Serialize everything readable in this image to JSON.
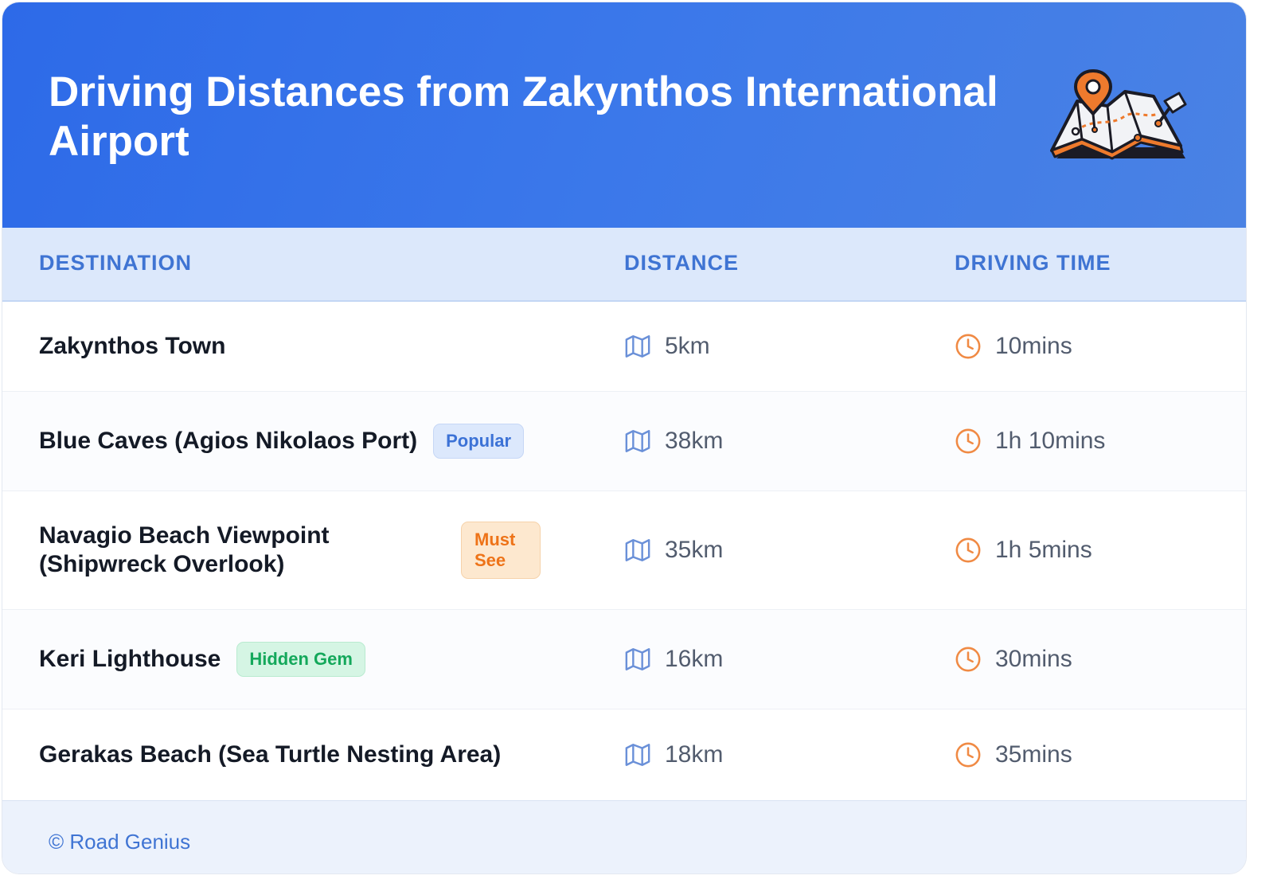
{
  "header": {
    "title": "Driving Distances from Zakynthos International Airport"
  },
  "table": {
    "columns": [
      "DESTINATION",
      "DISTANCE",
      "DRIVING TIME"
    ],
    "rows": [
      {
        "destination": "Zakynthos Town",
        "badge": "",
        "distance": "5km",
        "time": "10mins"
      },
      {
        "destination": "Blue Caves (Agios Nikolaos Port)",
        "badge": "Popular",
        "distance": "38km",
        "time": "1h 10mins"
      },
      {
        "destination": "Navagio Beach Viewpoint (Shipwreck Overlook)",
        "badge": "Must See",
        "distance": "35km",
        "time": "1h 5mins"
      },
      {
        "destination": "Keri Lighthouse",
        "badge": "Hidden Gem",
        "distance": "16km",
        "time": "30mins"
      },
      {
        "destination": "Gerakas Beach (Sea Turtle Nesting Area)",
        "badge": "",
        "distance": "18km",
        "time": "35mins"
      }
    ]
  },
  "icons": {
    "distance": "map-icon",
    "time": "clock-icon",
    "header": "map-with-location-pins-illustration"
  },
  "colors": {
    "header_bg": "#2d6ae8",
    "accent_blue": "#3f74d3",
    "accent_orange": "#f08a44",
    "badge_popular": "#3c72d6",
    "badge_must_see": "#ee7318",
    "badge_hidden_gem": "#14a85b"
  },
  "footer": {
    "text": "© Road Genius"
  }
}
